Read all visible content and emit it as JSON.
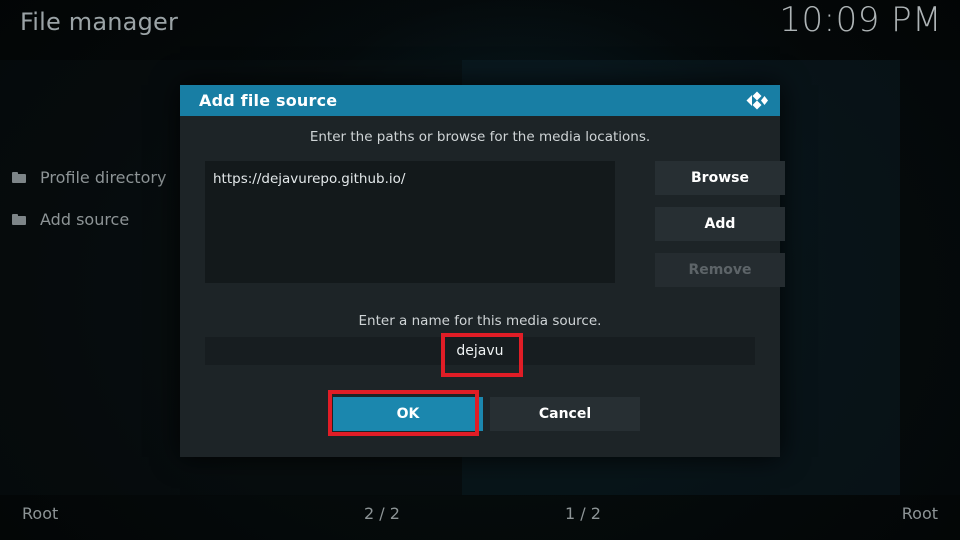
{
  "app": {
    "title": "File manager",
    "clock": "10:09 PM"
  },
  "sidebar": {
    "items": [
      {
        "label": "Profile directory",
        "icon": "folder-icon"
      },
      {
        "label": "Add source",
        "icon": "folder-icon"
      }
    ]
  },
  "statusbar": {
    "left_root": "Root",
    "left_count": "2 / 2",
    "right_count": "1 / 2",
    "right_root": "Root"
  },
  "dialog": {
    "title": "Add file source",
    "logo_icon": "kodi-logo-icon",
    "subtitle": "Enter the paths or browse for the media locations.",
    "paths": [
      "https://dejavurepo.github.io/"
    ],
    "buttons": {
      "browse": "Browse",
      "add": "Add",
      "remove": "Remove"
    },
    "name_label": "Enter a name for this media source.",
    "name_value": "dejavu",
    "actions": {
      "ok": "OK",
      "cancel": "Cancel"
    }
  },
  "colors": {
    "accent_teal": "#187ea4",
    "ok_button": "#1b87ae",
    "dialog_bg": "#1d2427",
    "highlight_red": "#e11d26",
    "text_primary": "#ffffff",
    "text_muted": "#8d9496",
    "text_disabled": "#5d6468"
  }
}
